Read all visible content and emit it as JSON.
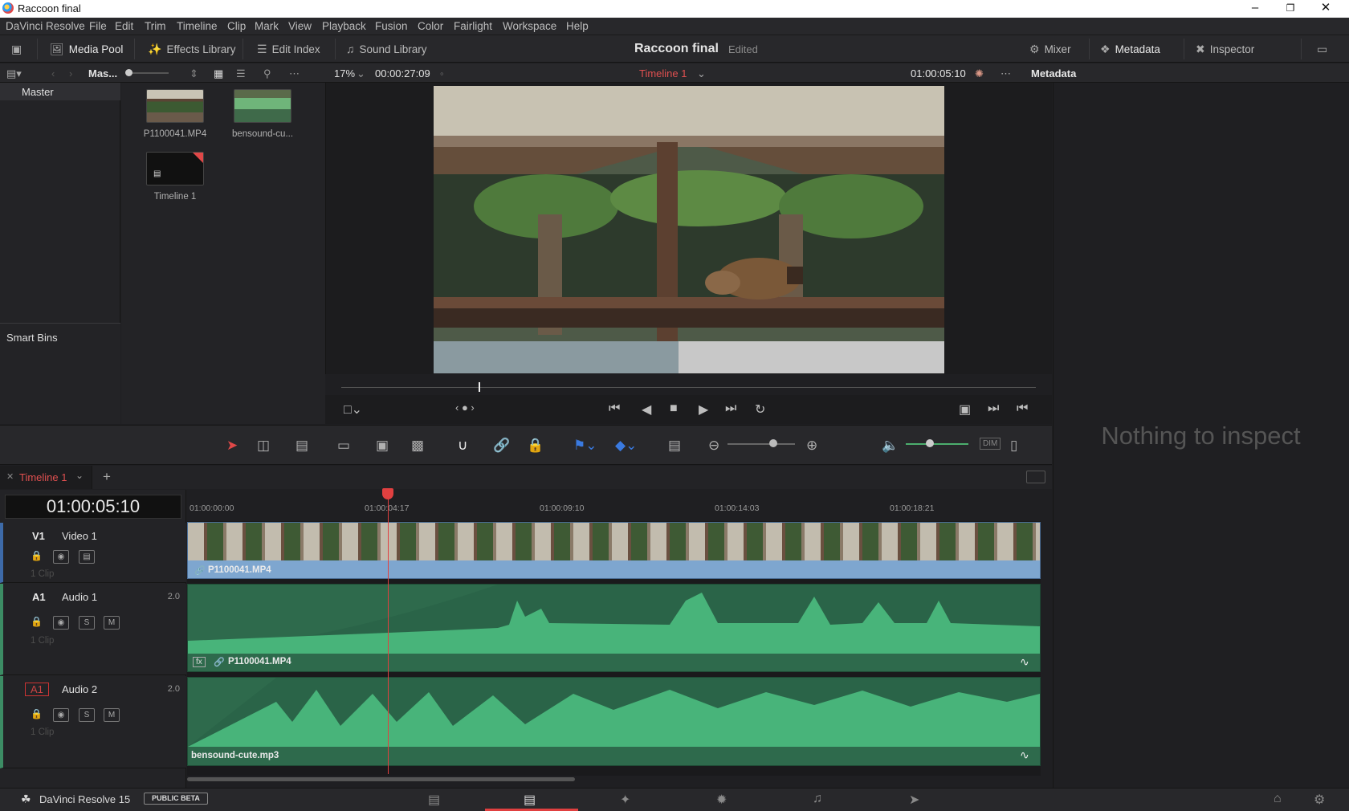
{
  "window": {
    "title": "Raccoon final"
  },
  "menu": [
    "DaVinci Resolve",
    "File",
    "Edit",
    "Trim",
    "Timeline",
    "Clip",
    "Mark",
    "View",
    "Playback",
    "Fusion",
    "Color",
    "Fairlight",
    "Workspace",
    "Help"
  ],
  "toolbar": {
    "media_pool": "Media Pool",
    "effects_library": "Effects Library",
    "edit_index": "Edit Index",
    "sound_library": "Sound Library",
    "project_name": "Raccoon final",
    "project_status": "Edited",
    "mixer": "Mixer",
    "metadata": "Metadata",
    "inspector": "Inspector"
  },
  "pool_header": {
    "bin_short": "Mas...",
    "zoom": "17%",
    "source_tc": "00:00:27:09",
    "timeline_name": "Timeline 1",
    "record_tc": "01:00:05:10",
    "panel_title": "Metadata"
  },
  "bins": {
    "master": "Master",
    "smart_bins": "Smart Bins"
  },
  "media": [
    {
      "name": "P1100041.MP4"
    },
    {
      "name": "bensound-cu..."
    },
    {
      "name": "Timeline 1"
    }
  ],
  "metadata_panel": {
    "empty_text": "Nothing to inspect"
  },
  "timeline": {
    "tab": "Timeline 1",
    "timecode": "01:00:05:10",
    "ruler": [
      "01:00:00:00",
      "01:00:04:17",
      "01:00:09:10",
      "01:00:14:03",
      "01:00:18:21"
    ],
    "playhead_fraction": 0.235,
    "tracks": [
      {
        "id": "V1",
        "name": "Video 1",
        "channels": "",
        "clip_count": "1 Clip",
        "clip": "P1100041.MP4"
      },
      {
        "id": "A1",
        "name": "Audio 1",
        "channels": "2.0",
        "clip_count": "1 Clip",
        "clip": "P1100041.MP4",
        "solo": "S",
        "mute": "M",
        "fx": "fx"
      },
      {
        "id": "A1",
        "name": "Audio 2",
        "channels": "2.0",
        "clip_count": "1 Clip",
        "clip": "bensound-cute.mp3",
        "solo": "S",
        "mute": "M"
      }
    ]
  },
  "bottom": {
    "app": "DaVinci Resolve 15",
    "badge": "PUBLIC BETA"
  },
  "edit_toolbar": {
    "dim": "DIM"
  },
  "colors": {
    "accent_red": "#e04040",
    "video_clip": "#7ea6cf",
    "audio_clip": "#3c8c64",
    "waveform": "#48b47a"
  }
}
